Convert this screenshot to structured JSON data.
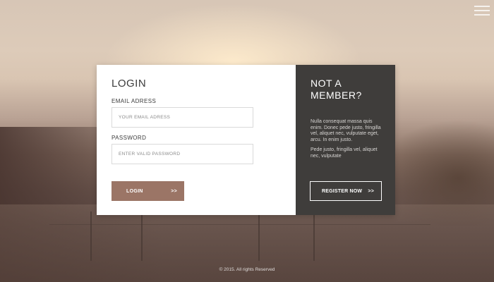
{
  "login": {
    "title": "LOGIN",
    "email_label": "EMAIL ADRESS",
    "email_placeholder": "YOUR EMAIL ADRESS",
    "password_label": "PASSWORD",
    "password_placeholder": "ENTER VALID PASSWORD",
    "button_label": "LOGIN",
    "button_arrow": ">>"
  },
  "member": {
    "title_line1": "NOT A",
    "title_line2": "MEMBER?",
    "text1": "Nulla consequat massa quis enim. Donec pede justo, fringilla vel, aliquet nec, vulputate eget, arcu. In enim justo.",
    "text2": "Pede justo, fringilla vel, aliquet nec, vulputate",
    "button_label": "REGISTER NOW",
    "button_arrow": ">>"
  },
  "footer": {
    "text": "© 2015. All rights Reserved"
  },
  "icons": {
    "menu": "hamburger-menu-icon"
  },
  "colors": {
    "login_button": "#9b7566",
    "member_panel": "#3f3d3b",
    "card": "#ffffff"
  }
}
